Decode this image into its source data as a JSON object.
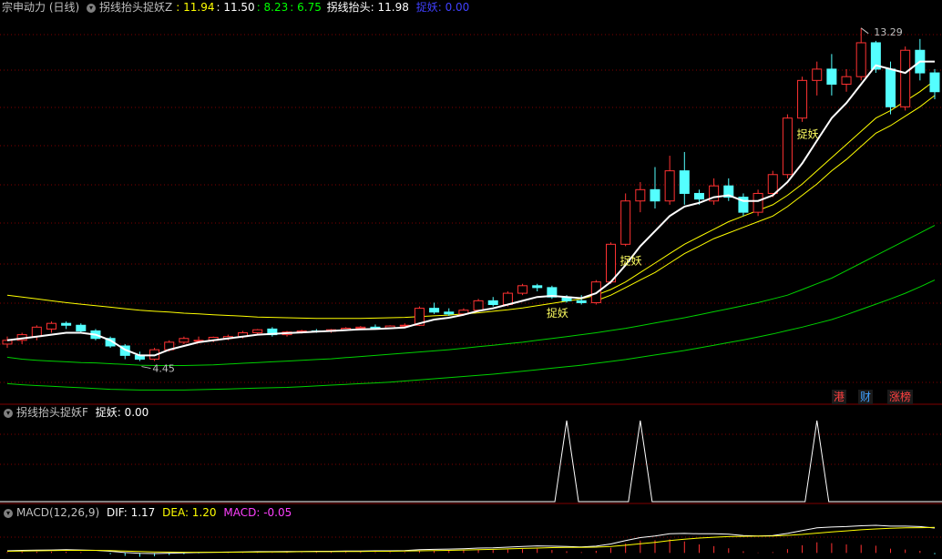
{
  "main_panel": {
    "title": "宗申动力 (日线)",
    "indicator_name": "拐线抬头捉妖Z",
    "values": [
      {
        "text": ": 11.94",
        "color": "#ffff00"
      },
      {
        "text": ": 11.50",
        "color": "#ffffff"
      },
      {
        "text": ": 8.23",
        "color": "#00ff00"
      },
      {
        "text": ": 6.75",
        "color": "#00ff00"
      }
    ],
    "line_label": "拐线抬头: 11.98",
    "signal_label": "捉妖: 0.00",
    "high_label": "13.29",
    "low_label": "4.45",
    "signal_marks": [
      "捉妖",
      "捉妖",
      "捉妖"
    ]
  },
  "badges": [
    {
      "text": "港",
      "color": "#ff4040"
    },
    {
      "text": "财",
      "color": "#40a0ff"
    },
    {
      "text": "涨榜",
      "color": "#ff4040"
    }
  ],
  "sub_panel": {
    "title": "拐线抬头捉妖F",
    "value_label": "捉妖: 0.00"
  },
  "macd_panel": {
    "title": "MACD(12,26,9)",
    "dif": "DIF: 1.17",
    "dea": "DEA: 1.20",
    "macd": "MACD: -0.05"
  },
  "colors": {
    "up": "#ff3232",
    "down": "#54ffff",
    "white_line": "#ffffff",
    "yellow_line": "#ffff00",
    "green_line": "#00d000",
    "grid": "#800000"
  },
  "chart_data": {
    "type": "candlestick",
    "candles": [
      [
        4.9,
        5.1,
        4.8,
        5.0
      ],
      [
        5.0,
        5.2,
        4.9,
        5.15
      ],
      [
        5.1,
        5.4,
        5.0,
        5.35
      ],
      [
        5.3,
        5.5,
        5.2,
        5.45
      ],
      [
        5.45,
        5.5,
        5.3,
        5.4
      ],
      [
        5.4,
        5.45,
        5.2,
        5.25
      ],
      [
        5.25,
        5.3,
        5.0,
        5.05
      ],
      [
        5.05,
        5.1,
        4.8,
        4.85
      ],
      [
        4.85,
        4.9,
        4.5,
        4.6
      ],
      [
        4.6,
        4.7,
        4.45,
        4.5
      ],
      [
        4.5,
        4.8,
        4.45,
        4.75
      ],
      [
        4.75,
        5.0,
        4.7,
        4.95
      ],
      [
        4.95,
        5.1,
        4.9,
        5.05
      ],
      [
        5.0,
        5.1,
        4.95,
        5.0
      ],
      [
        5.0,
        5.1,
        4.95,
        5.08
      ],
      [
        5.05,
        5.15,
        5.0,
        5.1
      ],
      [
        5.1,
        5.25,
        5.05,
        5.2
      ],
      [
        5.2,
        5.3,
        5.15,
        5.28
      ],
      [
        5.3,
        5.35,
        5.1,
        5.15
      ],
      [
        5.15,
        5.25,
        5.1,
        5.22
      ],
      [
        5.22,
        5.28,
        5.18,
        5.25
      ],
      [
        5.25,
        5.3,
        5.2,
        5.24
      ],
      [
        5.24,
        5.3,
        5.2,
        5.28
      ],
      [
        5.28,
        5.35,
        5.25,
        5.32
      ],
      [
        5.32,
        5.38,
        5.28,
        5.35
      ],
      [
        5.35,
        5.42,
        5.3,
        5.33
      ],
      [
        5.33,
        5.4,
        5.3,
        5.38
      ],
      [
        5.38,
        5.45,
        5.35,
        5.4
      ],
      [
        5.4,
        5.9,
        5.38,
        5.85
      ],
      [
        5.85,
        6.0,
        5.7,
        5.75
      ],
      [
        5.75,
        5.85,
        5.65,
        5.7
      ],
      [
        5.7,
        5.85,
        5.65,
        5.8
      ],
      [
        5.8,
        6.1,
        5.75,
        6.05
      ],
      [
        6.05,
        6.15,
        5.9,
        5.95
      ],
      [
        5.95,
        6.3,
        5.9,
        6.25
      ],
      [
        6.25,
        6.5,
        6.2,
        6.45
      ],
      [
        6.45,
        6.5,
        6.3,
        6.4
      ],
      [
        6.4,
        6.45,
        6.1,
        6.15
      ],
      [
        6.15,
        6.2,
        6.0,
        6.05
      ],
      [
        6.05,
        6.2,
        5.95,
        6.0
      ],
      [
        6.0,
        6.6,
        5.95,
        6.55
      ],
      [
        6.55,
        7.6,
        6.5,
        7.55
      ],
      [
        7.55,
        8.9,
        7.5,
        8.7
      ],
      [
        8.7,
        9.2,
        8.4,
        9.0
      ],
      [
        9.0,
        9.6,
        8.5,
        8.7
      ],
      [
        8.7,
        9.9,
        8.6,
        9.5
      ],
      [
        9.5,
        10.0,
        8.6,
        8.9
      ],
      [
        8.9,
        9.0,
        8.6,
        8.75
      ],
      [
        8.7,
        9.3,
        8.6,
        9.1
      ],
      [
        9.1,
        9.3,
        8.7,
        8.8
      ],
      [
        8.8,
        8.9,
        8.3,
        8.4
      ],
      [
        8.4,
        9.0,
        8.3,
        8.9
      ],
      [
        8.9,
        9.5,
        8.8,
        9.4
      ],
      [
        9.4,
        11.0,
        9.3,
        10.9
      ],
      [
        10.9,
        12.0,
        10.8,
        11.9
      ],
      [
        11.9,
        12.4,
        11.5,
        12.2
      ],
      [
        12.2,
        12.6,
        11.5,
        11.8
      ],
      [
        11.8,
        12.2,
        11.6,
        12.0
      ],
      [
        12.0,
        13.29,
        11.9,
        12.9
      ],
      [
        12.9,
        12.95,
        12.1,
        12.2
      ],
      [
        12.2,
        12.4,
        11.0,
        11.2
      ],
      [
        11.2,
        12.8,
        11.1,
        12.7
      ],
      [
        12.7,
        13.0,
        11.9,
        12.1
      ],
      [
        12.1,
        12.2,
        11.4,
        11.6
      ]
    ],
    "white_line": [
      5.0,
      5.05,
      5.1,
      5.15,
      5.2,
      5.2,
      5.15,
      5.0,
      4.75,
      4.6,
      4.6,
      4.75,
      4.85,
      4.95,
      5.0,
      5.05,
      5.1,
      5.15,
      5.17,
      5.19,
      5.21,
      5.23,
      5.25,
      5.27,
      5.29,
      5.3,
      5.32,
      5.34,
      5.45,
      5.55,
      5.6,
      5.68,
      5.78,
      5.85,
      5.95,
      6.05,
      6.15,
      6.18,
      6.15,
      6.12,
      6.25,
      6.55,
      7.0,
      7.5,
      7.9,
      8.3,
      8.55,
      8.65,
      8.8,
      8.85,
      8.7,
      8.7,
      8.85,
      9.2,
      9.7,
      10.3,
      10.9,
      11.3,
      11.8,
      12.3,
      12.2,
      12.1,
      12.4,
      12.4
    ],
    "yellow_upper": [
      6.2,
      6.15,
      6.1,
      6.05,
      6.0,
      5.96,
      5.92,
      5.88,
      5.84,
      5.8,
      5.77,
      5.75,
      5.72,
      5.7,
      5.68,
      5.66,
      5.64,
      5.62,
      5.61,
      5.6,
      5.59,
      5.58,
      5.58,
      5.58,
      5.58,
      5.59,
      5.6,
      5.61,
      5.63,
      5.65,
      5.67,
      5.7,
      5.73,
      5.77,
      5.81,
      5.86,
      5.92,
      5.98,
      6.04,
      6.1,
      6.2,
      6.35,
      6.55,
      6.8,
      7.05,
      7.3,
      7.55,
      7.75,
      7.95,
      8.15,
      8.3,
      8.45,
      8.6,
      8.85,
      9.15,
      9.5,
      9.85,
      10.2,
      10.55,
      10.9,
      11.1,
      11.35,
      11.6,
      11.9
    ],
    "yellow_lower": [
      null,
      null,
      null,
      null,
      null,
      null,
      null,
      null,
      null,
      null,
      null,
      null,
      null,
      null,
      null,
      null,
      null,
      null,
      null,
      null,
      null,
      null,
      null,
      null,
      null,
      null,
      null,
      null,
      null,
      null,
      null,
      null,
      null,
      null,
      null,
      null,
      null,
      null,
      null,
      null,
      6.05,
      6.2,
      6.4,
      6.6,
      6.8,
      7.05,
      7.3,
      7.5,
      7.7,
      7.85,
      8.0,
      8.15,
      8.3,
      8.55,
      8.85,
      9.15,
      9.5,
      9.8,
      10.15,
      10.5,
      10.7,
      10.95,
      11.2,
      11.5
    ],
    "green_upper": [
      4.55,
      4.5,
      4.47,
      4.45,
      4.43,
      4.41,
      4.4,
      4.38,
      4.36,
      4.34,
      4.33,
      4.33,
      4.33,
      4.34,
      4.35,
      4.37,
      4.39,
      4.41,
      4.43,
      4.45,
      4.47,
      4.49,
      4.51,
      4.54,
      4.57,
      4.6,
      4.63,
      4.66,
      4.69,
      4.72,
      4.75,
      4.79,
      4.83,
      4.87,
      4.91,
      4.95,
      5.0,
      5.05,
      5.1,
      5.15,
      5.2,
      5.26,
      5.32,
      5.39,
      5.46,
      5.53,
      5.6,
      5.68,
      5.76,
      5.84,
      5.92,
      6.0,
      6.1,
      6.2,
      6.35,
      6.5,
      6.65,
      6.85,
      7.05,
      7.25,
      7.45,
      7.65,
      7.85,
      8.05
    ],
    "green_lower": [
      3.85,
      3.82,
      3.8,
      3.78,
      3.76,
      3.74,
      3.72,
      3.7,
      3.69,
      3.68,
      3.68,
      3.68,
      3.68,
      3.69,
      3.7,
      3.71,
      3.72,
      3.73,
      3.74,
      3.75,
      3.77,
      3.79,
      3.81,
      3.83,
      3.85,
      3.87,
      3.89,
      3.92,
      3.95,
      3.98,
      4.01,
      4.04,
      4.07,
      4.1,
      4.14,
      4.18,
      4.22,
      4.26,
      4.3,
      4.34,
      4.39,
      4.44,
      4.49,
      4.55,
      4.61,
      4.67,
      4.73,
      4.8,
      4.87,
      4.94,
      5.01,
      5.09,
      5.17,
      5.26,
      5.35,
      5.45,
      5.55,
      5.68,
      5.82,
      5.96,
      6.1,
      6.25,
      6.42,
      6.6
    ],
    "signal_spikes": [
      {
        "index": 38,
        "value": 1
      },
      {
        "index": 43,
        "value": 1
      },
      {
        "index": 55,
        "value": 1
      }
    ],
    "signal_marks": [
      {
        "index": 37
      },
      {
        "index": 42
      },
      {
        "index": 54
      }
    ],
    "macd": {
      "dif": [
        0.1,
        0.12,
        0.13,
        0.14,
        0.15,
        0.14,
        0.12,
        0.08,
        0.02,
        -0.02,
        -0.03,
        -0.01,
        0.0,
        0.02,
        0.03,
        0.04,
        0.05,
        0.06,
        0.06,
        0.07,
        0.07,
        0.08,
        0.08,
        0.09,
        0.09,
        0.1,
        0.1,
        0.11,
        0.15,
        0.17,
        0.18,
        0.2,
        0.23,
        0.24,
        0.27,
        0.3,
        0.33,
        0.32,
        0.3,
        0.28,
        0.32,
        0.42,
        0.58,
        0.72,
        0.8,
        0.9,
        0.92,
        0.9,
        0.9,
        0.88,
        0.82,
        0.8,
        0.82,
        0.92,
        1.05,
        1.18,
        1.22,
        1.24,
        1.28,
        1.3,
        1.26,
        1.26,
        1.24,
        1.17
      ],
      "dea": [
        0.08,
        0.09,
        0.1,
        0.11,
        0.12,
        0.12,
        0.12,
        0.11,
        0.09,
        0.07,
        0.05,
        0.04,
        0.03,
        0.03,
        0.03,
        0.03,
        0.04,
        0.04,
        0.05,
        0.05,
        0.06,
        0.06,
        0.06,
        0.07,
        0.07,
        0.08,
        0.08,
        0.09,
        0.1,
        0.11,
        0.12,
        0.14,
        0.15,
        0.17,
        0.19,
        0.21,
        0.23,
        0.25,
        0.26,
        0.26,
        0.27,
        0.3,
        0.36,
        0.43,
        0.5,
        0.58,
        0.65,
        0.7,
        0.74,
        0.77,
        0.78,
        0.79,
        0.8,
        0.83,
        0.87,
        0.93,
        0.99,
        1.04,
        1.09,
        1.13,
        1.16,
        1.18,
        1.19,
        1.2
      ]
    }
  }
}
